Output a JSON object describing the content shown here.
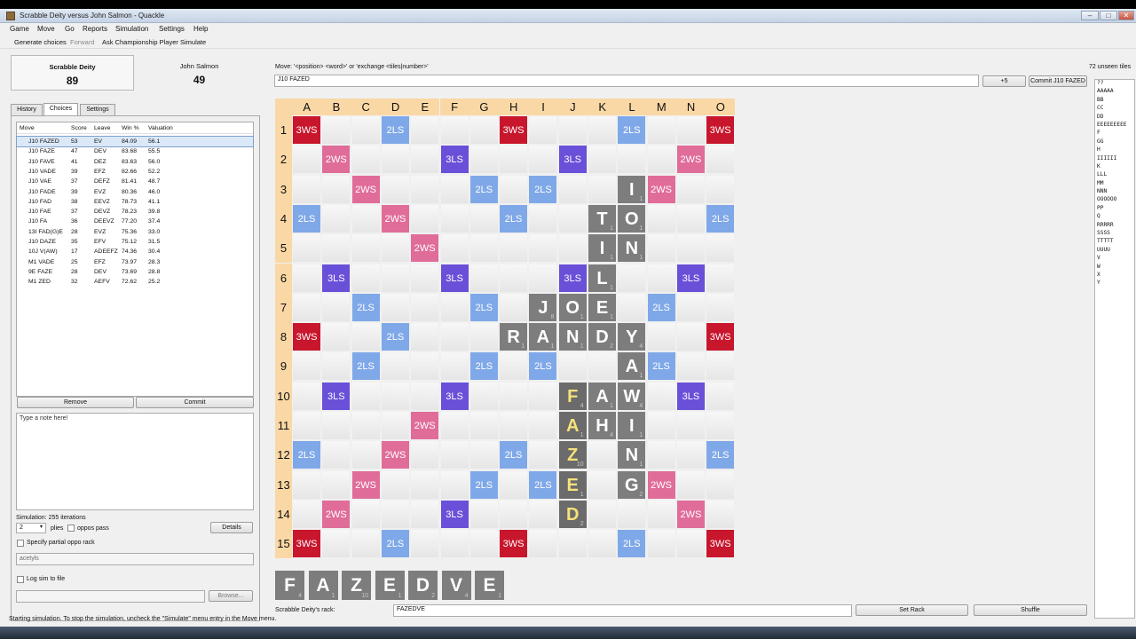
{
  "window": {
    "title": "Scrabble Deity versus John Salmon - Quackle"
  },
  "menu": [
    "Game",
    "Move",
    "Go",
    "Reports",
    "Simulation",
    "Settings",
    "Help"
  ],
  "toolbar": {
    "generate": "Generate choices",
    "forward": "Forward",
    "ask": "Ask Championship Player",
    "simulate": "Simulate"
  },
  "players": [
    {
      "name": "Scrabble Deity",
      "score": "89"
    },
    {
      "name": "John Salmon",
      "score": "49"
    }
  ],
  "tabs": [
    "History",
    "Choices",
    "Settings"
  ],
  "moves": {
    "headers": [
      "Move",
      "Score",
      "Leave",
      "Win %",
      "Valuation"
    ],
    "rows": [
      [
        "J10 FAZED",
        "53",
        "EV",
        "84.09",
        "56.1"
      ],
      [
        "J10 FAZE",
        "47",
        "DEV",
        "83.68",
        "55.5"
      ],
      [
        "J10 FAVE",
        "41",
        "DEZ",
        "83.63",
        "56.0"
      ],
      [
        "J10 VADE",
        "39",
        "EFZ",
        "82.66",
        "52.2"
      ],
      [
        "J10 VAE",
        "37",
        "DEFZ",
        "81.41",
        "48.7"
      ],
      [
        "J10 FADE",
        "39",
        "EVZ",
        "80.36",
        "46.0"
      ],
      [
        "J10 FAD",
        "38",
        "EEVZ",
        "78.73",
        "41.1"
      ],
      [
        "J10 FAE",
        "37",
        "DEVZ",
        "78.23",
        "39.8"
      ],
      [
        "J10 FA",
        "36",
        "DEEVZ",
        "77.20",
        "37.4"
      ],
      [
        "13I FAD(G)E",
        "28",
        "EVZ",
        "75.36",
        "33.0"
      ],
      [
        "J10 DAZE",
        "35",
        "EFV",
        "75.12",
        "31.5"
      ],
      [
        "10J V(AW)",
        "17",
        "ADEEFZ",
        "74.36",
        "30.4"
      ],
      [
        "M1 VADE",
        "25",
        "EFZ",
        "73.97",
        "28.3"
      ],
      [
        "9E FAZE",
        "28",
        "DEV",
        "73.69",
        "28.8"
      ],
      [
        "M1 ZED",
        "32",
        "AEFV",
        "72.62",
        "25.2"
      ]
    ]
  },
  "buttons": {
    "remove": "Remove",
    "commit": "Commit",
    "details": "Details",
    "browse": "Browse...",
    "plus5": "+5",
    "commit_move": "Commit J10 FAZED",
    "set_rack": "Set Rack",
    "shuffle": "Shuffle"
  },
  "note_placeholder": "Type a note here!",
  "simulation": {
    "iterations_label": "Simulation: 255 iterations",
    "plies_value": "2",
    "plies_label": "plies",
    "oppos_pass": "oppos pass",
    "partial_rack_label": "Specify partial oppo rack",
    "partial_rack_value": "acetyls",
    "log_label": "Log sim to file"
  },
  "move_input": {
    "label": "Move: '<position> <word>' or 'exchange <tiles|number>'",
    "value": "J10 FAZED"
  },
  "board": {
    "columns": [
      "A",
      "B",
      "C",
      "D",
      "E",
      "F",
      "G",
      "H",
      "I",
      "J",
      "K",
      "L",
      "M",
      "N",
      "O"
    ],
    "rows": [
      "1",
      "2",
      "3",
      "4",
      "5",
      "6",
      "7",
      "8",
      "9",
      "10",
      "11",
      "12",
      "13",
      "14",
      "15"
    ],
    "premiums": [
      "TW..DL...TW...DL..TW",
      ".DW...TL...TL...DW.",
      "..DW...DL.DL...DW..",
      "DL..DW...DL...DW..DL",
      "....DW.....DW....",
      ".TL...TL...TL...TL.",
      "..DL...DL.DL...DL..",
      "TW..DL...DW...DL..TW"
    ],
    "tiles": [
      {
        "r": 3,
        "c": 12,
        "l": "I",
        "v": "1",
        "n": false
      },
      {
        "r": 4,
        "c": 11,
        "l": "T",
        "v": "1",
        "n": false
      },
      {
        "r": 4,
        "c": 12,
        "l": "O",
        "v": "1",
        "n": false
      },
      {
        "r": 5,
        "c": 11,
        "l": "I",
        "v": "1",
        "n": false
      },
      {
        "r": 5,
        "c": 12,
        "l": "N",
        "v": "1",
        "n": false
      },
      {
        "r": 6,
        "c": 11,
        "l": "L",
        "v": "1",
        "n": false
      },
      {
        "r": 7,
        "c": 9,
        "l": "J",
        "v": "8",
        "n": false
      },
      {
        "r": 7,
        "c": 10,
        "l": "O",
        "v": "1",
        "n": false
      },
      {
        "r": 7,
        "c": 11,
        "l": "E",
        "v": "1",
        "n": false
      },
      {
        "r": 8,
        "c": 8,
        "l": "R",
        "v": "1",
        "n": false
      },
      {
        "r": 8,
        "c": 9,
        "l": "A",
        "v": "1",
        "n": false
      },
      {
        "r": 8,
        "c": 10,
        "l": "N",
        "v": "1",
        "n": false
      },
      {
        "r": 8,
        "c": 11,
        "l": "D",
        "v": "2",
        "n": false
      },
      {
        "r": 8,
        "c": 12,
        "l": "Y",
        "v": "4",
        "n": false
      },
      {
        "r": 9,
        "c": 12,
        "l": "A",
        "v": "1",
        "n": false
      },
      {
        "r": 10,
        "c": 10,
        "l": "F",
        "v": "4",
        "n": true
      },
      {
        "r": 10,
        "c": 11,
        "l": "A",
        "v": "1",
        "n": false
      },
      {
        "r": 10,
        "c": 12,
        "l": "W",
        "v": "4",
        "n": false
      },
      {
        "r": 11,
        "c": 10,
        "l": "A",
        "v": "1",
        "n": true
      },
      {
        "r": 11,
        "c": 11,
        "l": "H",
        "v": "4",
        "n": false
      },
      {
        "r": 11,
        "c": 12,
        "l": "I",
        "v": "1",
        "n": false
      },
      {
        "r": 12,
        "c": 10,
        "l": "Z",
        "v": "10",
        "n": true
      },
      {
        "r": 12,
        "c": 12,
        "l": "N",
        "v": "1",
        "n": false
      },
      {
        "r": 13,
        "c": 10,
        "l": "E",
        "v": "1",
        "n": true
      },
      {
        "r": 13,
        "c": 12,
        "l": "G",
        "v": "2",
        "n": false
      },
      {
        "r": 14,
        "c": 10,
        "l": "D",
        "v": "2",
        "n": true
      }
    ]
  },
  "rack": {
    "tiles": [
      {
        "l": "F",
        "v": "4"
      },
      {
        "l": "A",
        "v": "1"
      },
      {
        "l": "Z",
        "v": "10"
      },
      {
        "l": "E",
        "v": "1"
      },
      {
        "l": "D",
        "v": "2"
      },
      {
        "l": "V",
        "v": "4"
      },
      {
        "l": "E",
        "v": "1"
      }
    ],
    "label": "Scrabble Deity's rack:",
    "value": "FAZEDVE"
  },
  "unseen": {
    "header": "72 unseen tiles",
    "lines": [
      "??",
      "AAAAA",
      "BB",
      "CC",
      "DD",
      "EEEEEEEEE",
      "F",
      "GG",
      "H",
      "IIIIII",
      "K",
      "LLL",
      "MM",
      "NNN",
      "OOOOOO",
      "PP",
      "Q",
      "RRRRR",
      "SSSS",
      "TTTTT",
      "UUUU",
      "V",
      "W",
      "X",
      "Y"
    ]
  },
  "status": "Starting simulation. To stop the simulation, uncheck the \"Simulate\" menu entry in the Move menu."
}
